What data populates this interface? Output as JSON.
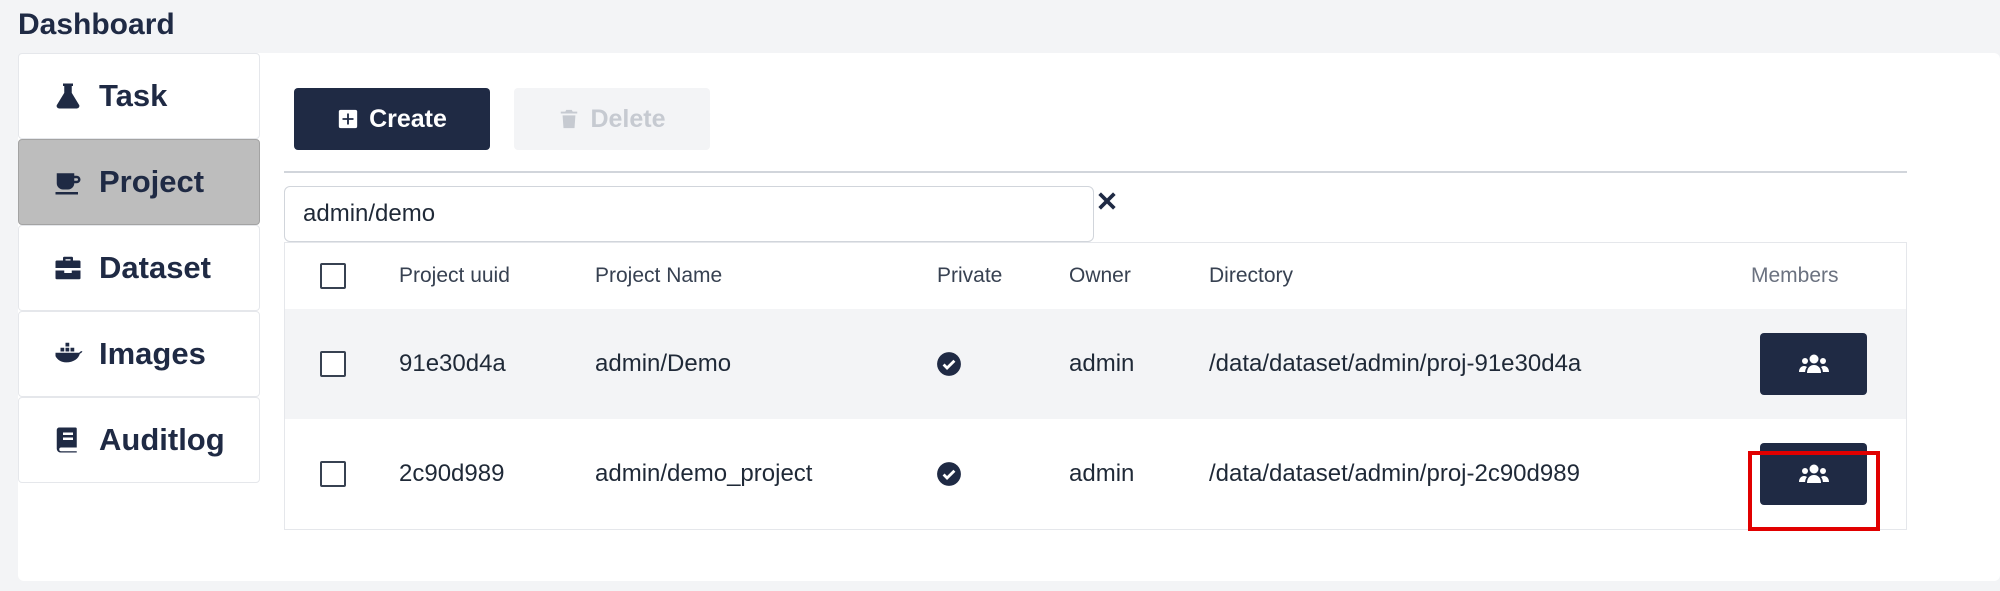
{
  "page": {
    "title": "Dashboard"
  },
  "sidebar": {
    "items": [
      {
        "label": "Task",
        "icon": "flask-icon",
        "active": false
      },
      {
        "label": "Project",
        "icon": "coffee-cup-icon",
        "active": true
      },
      {
        "label": "Dataset",
        "icon": "toolbox-icon",
        "active": false
      },
      {
        "label": "Images",
        "icon": "docker-whale-icon",
        "active": false
      },
      {
        "label": "Auditlog",
        "icon": "book-icon",
        "active": false
      }
    ]
  },
  "toolbar": {
    "create_label": "Create",
    "delete_label": "Delete",
    "delete_disabled": true
  },
  "search": {
    "value": "admin/demo",
    "placeholder": ""
  },
  "table": {
    "headers": {
      "uuid": "Project uuid",
      "name": "Project Name",
      "private": "Private",
      "owner": "Owner",
      "directory": "Directory",
      "members": "Members"
    },
    "rows": [
      {
        "uuid": "91e30d4a",
        "name": "admin/Demo",
        "private": true,
        "owner": "admin",
        "directory": "/data/dataset/admin/proj-91e30d4a"
      },
      {
        "uuid": "2c90d989",
        "name": "admin/demo_project",
        "private": true,
        "owner": "admin",
        "directory": "/data/dataset/admin/proj-2c90d989"
      }
    ]
  },
  "colors": {
    "accent": "#1f2a44",
    "active_sidebar": "#bdbdbd",
    "highlight": "#e10000"
  }
}
